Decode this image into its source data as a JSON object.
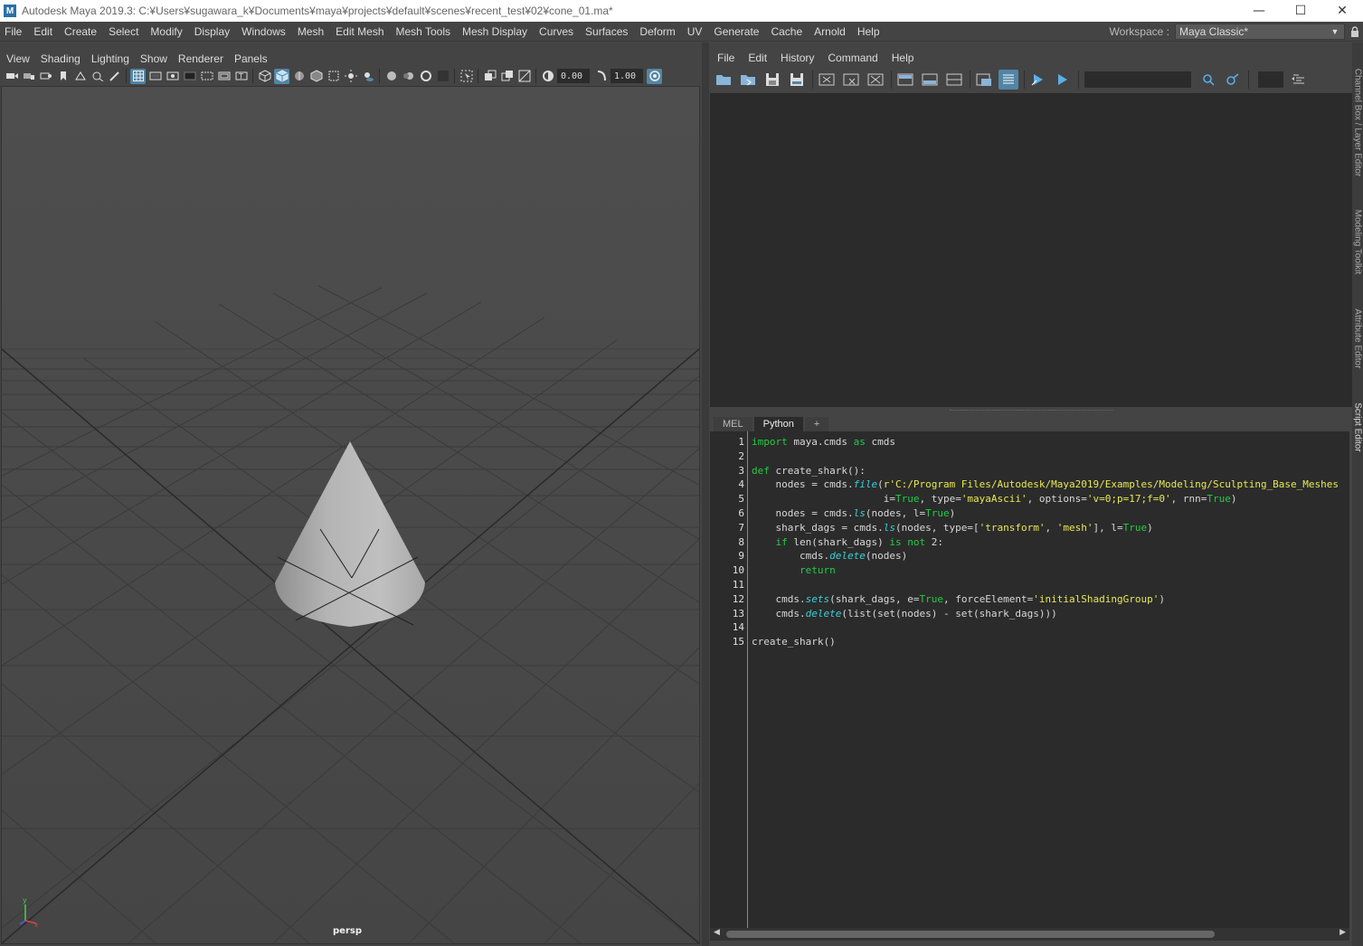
{
  "window": {
    "title": "Autodesk Maya 2019.3: C:¥Users¥sugawara_k¥Documents¥maya¥projects¥default¥scenes¥recent_test¥02¥cone_01.ma*",
    "logo_letter": "M",
    "minimize": "—",
    "maximize": "☐",
    "close": "✕"
  },
  "main_menu": [
    "File",
    "Edit",
    "Create",
    "Select",
    "Modify",
    "Display",
    "Windows",
    "Mesh",
    "Edit Mesh",
    "Mesh Tools",
    "Mesh Display",
    "Curves",
    "Surfaces",
    "Deform",
    "UV",
    "Generate",
    "Cache",
    "Arnold",
    "Help"
  ],
  "workspace": {
    "label": "Workspace :",
    "value": "Maya Classic*"
  },
  "viewport": {
    "menu": [
      "View",
      "Shading",
      "Lighting",
      "Show",
      "Renderer",
      "Panels"
    ],
    "field_1": "0.00",
    "field_2": "1.00",
    "camera_label": "persp"
  },
  "script_editor": {
    "menu": [
      "File",
      "Edit",
      "History",
      "Command",
      "Help"
    ],
    "tabs": [
      "MEL",
      "Python",
      "+"
    ],
    "active_tab": "Python",
    "line_numbers": [
      "1",
      "2",
      "3",
      "4",
      "5",
      "6",
      "7",
      "8",
      "9",
      "10",
      "11",
      "12",
      "13",
      "14",
      "15"
    ],
    "code_lines": [
      "import maya.cmds as cmds",
      "",
      "def create_shark():",
      "    nodes = cmds.file(r'C:/Program Files/Autodesk/Maya2019/Examples/Modeling/Sculpting_Base_Meshes",
      "                      i=True, type='mayaAscii', options='v=0;p=17;f=0', rnn=True)",
      "    nodes = cmds.ls(nodes, l=True)",
      "    shark_dags = cmds.ls(nodes, type=['transform', 'mesh'], l=True)",
      "    if len(shark_dags) is not 2:",
      "        cmds.delete(nodes)",
      "        return",
      "",
      "    cmds.sets(shark_dags, e=True, forceElement='initialShadingGroup')",
      "    cmds.delete(list(set(nodes) - set(shark_dags)))",
      "",
      "create_shark()"
    ]
  },
  "side_tabs": [
    "Channel Box / Layer Editor",
    "Modeling Toolkit",
    "Attribute Editor",
    "Script Editor"
  ],
  "colors": {
    "keyword": "#22cc44",
    "function": "#3ad0d8",
    "string": "#e8e854",
    "highlight": "#5285a6"
  }
}
